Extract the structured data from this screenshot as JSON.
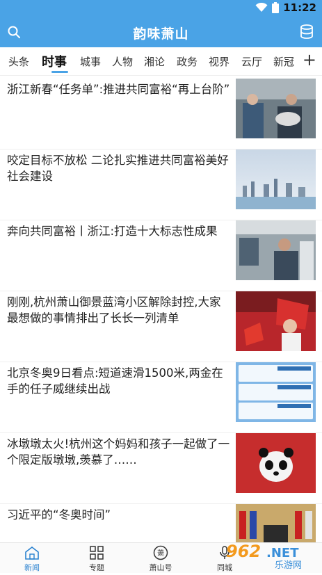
{
  "status": {
    "time": "11:22"
  },
  "header": {
    "title": "韵味萧山",
    "search_icon": "search-icon",
    "db_icon": "database-icon"
  },
  "colors": {
    "brand": "#4aa3e6",
    "active_nav": "#2a82d0"
  },
  "tabs": [
    {
      "label": "头条"
    },
    {
      "label": "时事"
    },
    {
      "label": "城事"
    },
    {
      "label": "人物"
    },
    {
      "label": "湘论"
    },
    {
      "label": "政务"
    },
    {
      "label": "视界"
    },
    {
      "label": "云厅"
    },
    {
      "label": "新冠"
    }
  ],
  "active_tab": "时事",
  "add_tab": "+",
  "news": [
    {
      "title": "浙江新春“任务单”:推进共同富裕“再上台阶”",
      "image": "factory-workers-photo"
    },
    {
      "title": "咬定目标不放松 二论扎实推进共同富裕美好社会建设",
      "image": "city-skyline-photo"
    },
    {
      "title": "奔向共同富裕丨浙江:打造十大标志性成果",
      "image": "workshop-photo"
    },
    {
      "title": "刚刚,杭州萧山御景蓝湾小区解除封控,大家最想做的事情排出了长长一列清单",
      "image": "celebration-photo"
    },
    {
      "title": "北京冬奥9日看点:短道速滑1500米,两金在手的任子威继续出战",
      "image": "schedule-graphic"
    },
    {
      "title": "冰墩墩太火!杭州这个妈妈和孩子一起做了一个限定版墩墩,羡慕了……",
      "image": "panda-craft-photo"
    },
    {
      "title": "习近平的“冬奥时间”",
      "image": "meeting-photo"
    }
  ],
  "bottom_nav": [
    {
      "label": "新闻",
      "icon": "home-icon"
    },
    {
      "label": "专题",
      "icon": "grid-icon"
    },
    {
      "label": "萧山号",
      "icon": "badge-icon",
      "badge": "萧"
    },
    {
      "label": "同城",
      "icon": "mic-icon"
    }
  ],
  "watermark": {
    "brand": "962",
    "domain": ".NET",
    "sub": "乐游网"
  }
}
